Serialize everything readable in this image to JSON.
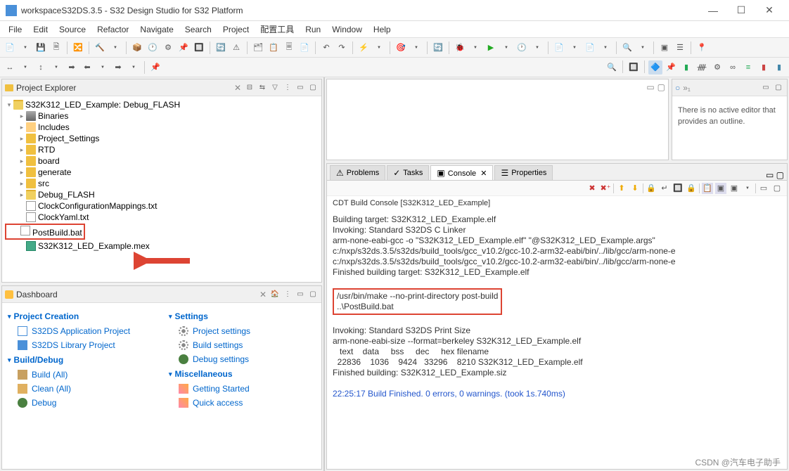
{
  "title": "workspaceS32DS.3.5 - S32 Design Studio for S32 Platform",
  "menu": [
    "File",
    "Edit",
    "Source",
    "Refactor",
    "Navigate",
    "Search",
    "Project",
    "配置工具",
    "Run",
    "Window",
    "Help"
  ],
  "projectExplorer": {
    "title": "Project Explorer",
    "root": "S32K312_LED_Example: Debug_FLASH",
    "children": [
      {
        "label": "Binaries",
        "icon": "bin",
        "expand": true
      },
      {
        "label": "Includes",
        "icon": "inc",
        "expand": true
      },
      {
        "label": "Project_Settings",
        "icon": "folder",
        "expand": true
      },
      {
        "label": "RTD",
        "icon": "folder",
        "expand": true
      },
      {
        "label": "board",
        "icon": "folder",
        "expand": true
      },
      {
        "label": "generate",
        "icon": "folder",
        "expand": true
      },
      {
        "label": "src",
        "icon": "folder",
        "expand": true
      },
      {
        "label": "Debug_FLASH",
        "icon": "folder-open",
        "expand": true
      },
      {
        "label": "ClockConfigurationMappings.txt",
        "icon": "file",
        "expand": false
      },
      {
        "label": "ClockYaml.txt",
        "icon": "file",
        "expand": false
      },
      {
        "label": "PostBuild.bat",
        "icon": "file",
        "expand": false,
        "highlight": true
      },
      {
        "label": "S32K312_LED_Example.mex",
        "icon": "chip",
        "expand": false
      }
    ]
  },
  "dashboard": {
    "title": "Dashboard",
    "groups": [
      {
        "title": "Project Creation",
        "links": [
          {
            "label": "S32DS Application Project",
            "icon": "page"
          },
          {
            "label": "S32DS Library Project",
            "icon": "book"
          }
        ]
      },
      {
        "title": "Build/Debug",
        "links": [
          {
            "label": "Build  (All)",
            "icon": "hammer"
          },
          {
            "label": "Clean  (All)",
            "icon": "broom"
          },
          {
            "label": "Debug",
            "icon": "bug"
          }
        ]
      }
    ],
    "groups2": [
      {
        "title": "Settings",
        "links": [
          {
            "label": "Project settings",
            "icon": "gear"
          },
          {
            "label": "Build settings",
            "icon": "gear"
          },
          {
            "label": "Debug settings",
            "icon": "bug"
          }
        ]
      },
      {
        "title": "Miscellaneous",
        "links": [
          {
            "label": "Getting Started",
            "icon": "wand"
          },
          {
            "label": "Quick access",
            "icon": "wand"
          }
        ]
      }
    ]
  },
  "outline": {
    "title": "",
    "msg": "There is no active editor that provides an outline."
  },
  "tabs": [
    {
      "label": "Problems",
      "icon": "⚠"
    },
    {
      "label": "Tasks",
      "icon": "✓"
    },
    {
      "label": "Console",
      "icon": "▣",
      "active": true
    },
    {
      "label": "Properties",
      "icon": "☰"
    }
  ],
  "console": {
    "title": "CDT Build Console [S32K312_LED_Example]",
    "lines1": "Building target: S32K312_LED_Example.elf\nInvoking: Standard S32DS C Linker\narm-none-eabi-gcc -o \"S32K312_LED_Example.elf\" \"@S32K312_LED_Example.args\"\nc:/nxp/s32ds.3.5/s32ds/build_tools/gcc_v10.2/gcc-10.2-arm32-eabi/bin/../lib/gcc/arm-none-e\nc:/nxp/s32ds.3.5/s32ds/build_tools/gcc_v10.2/gcc-10.2-arm32-eabi/bin/../lib/gcc/arm-none-e\nFinished building target: S32K312_LED_Example.elf\n ",
    "highlight": "/usr/bin/make --no-print-directory post-build\n..\\PostBuild.bat",
    "lines2": " \nInvoking: Standard S32DS Print Size\narm-none-eabi-size --format=berkeley S32K312_LED_Example.elf\n   text    data     bss     dec     hex filename\n  22836    1036    9424   33296    8210 S32K312_LED_Example.elf\nFinished building: S32K312_LED_Example.siz\n \n",
    "status": "22:25:17 Build Finished. 0 errors, 0 warnings. (took 1s.740ms)"
  },
  "watermark": "CSDN @汽车电子助手"
}
